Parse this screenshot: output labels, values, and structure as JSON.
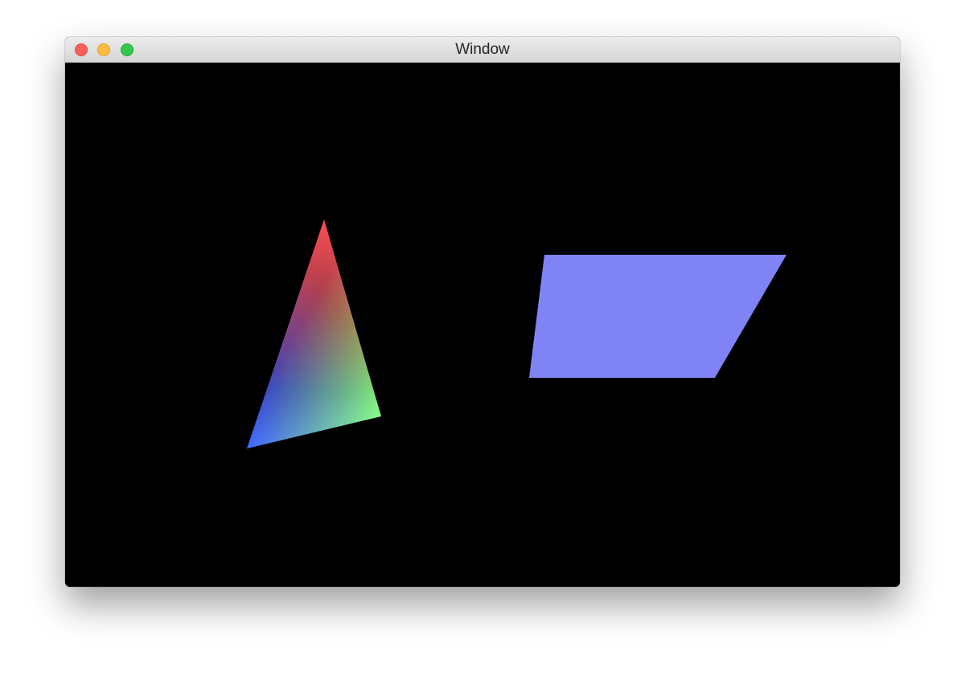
{
  "window": {
    "title": "Window",
    "controls": {
      "close": "close-icon",
      "minimize": "minimize-icon",
      "zoom": "zoom-icon"
    },
    "colors": {
      "close": "#fc605c",
      "minimize": "#fdbc40",
      "zoom": "#34c84a"
    }
  },
  "viewport": {
    "background": "#000000",
    "triangle": {
      "vertex_colors": {
        "top": "#ff2a1a",
        "bottom_left": "#0030ff",
        "right": "#66ff44"
      }
    },
    "parallelogram": {
      "fill": "#8083f5"
    }
  }
}
